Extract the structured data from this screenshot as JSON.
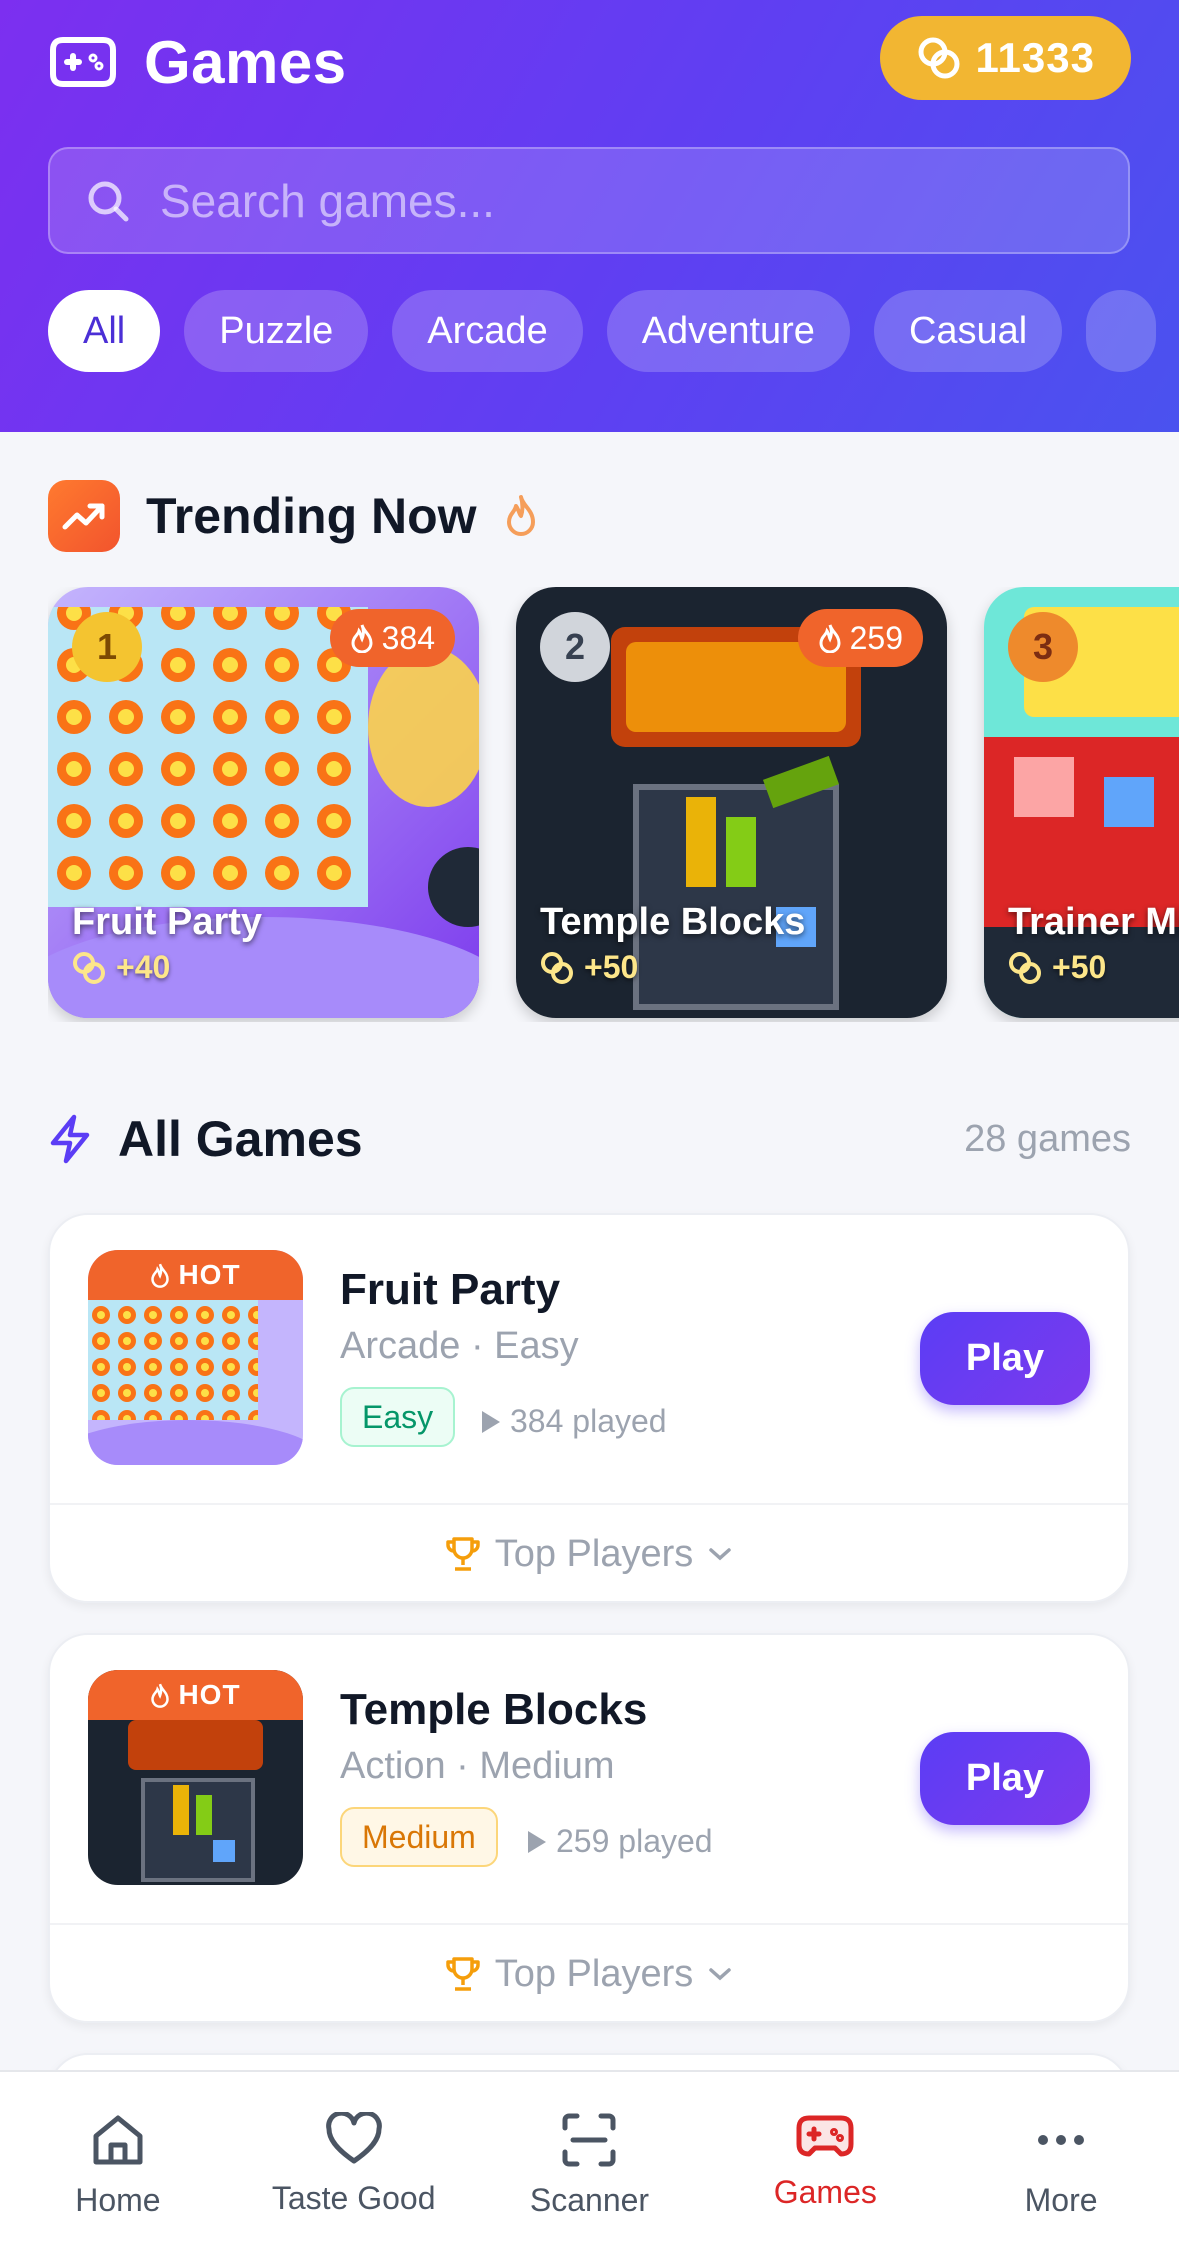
{
  "header": {
    "title": "Games",
    "coins": "11333",
    "search_placeholder": "Search games...",
    "categories": [
      "All",
      "Puzzle",
      "Arcade",
      "Adventure",
      "Casual",
      ""
    ],
    "active_category": "All"
  },
  "trending": {
    "title": "Trending Now",
    "items": [
      {
        "rank": "1",
        "name": "Fruit Party",
        "plays": "384",
        "reward": "+40",
        "rank_color": "#f4c430"
      },
      {
        "rank": "2",
        "name": "Temple Blocks",
        "plays": "259",
        "reward": "+50",
        "rank_color": "#d1d5db"
      },
      {
        "rank": "3",
        "name": "Trainer Mi",
        "plays": "",
        "reward": "+50",
        "rank_color": "#ee8a2c"
      }
    ]
  },
  "all_games": {
    "title": "All Games",
    "count": "28 games",
    "items": [
      {
        "name": "Fruit Party",
        "meta": "Arcade · Easy",
        "difficulty": "Easy",
        "played": "384 played",
        "badge": "HOT",
        "play_label": "Play",
        "top_players_label": "Top Players"
      },
      {
        "name": "Temple Blocks",
        "meta": "Action · Medium",
        "difficulty": "Medium",
        "played": "259 played",
        "badge": "HOT",
        "play_label": "Play",
        "top_players_label": "Top Players"
      }
    ]
  },
  "nav": {
    "items": [
      {
        "label": "Home",
        "icon": "home-icon"
      },
      {
        "label": "Taste Good",
        "icon": "heart-icon"
      },
      {
        "label": "Scanner",
        "icon": "scanner-icon"
      },
      {
        "label": "Games",
        "icon": "gamepad-icon"
      },
      {
        "label": "More",
        "icon": "more-icon"
      }
    ],
    "active": "Games"
  },
  "colors": {
    "accent": "#5b3df5",
    "active_nav": "#dc2626",
    "coin": "#f2b632",
    "hot": "#f0642b"
  }
}
